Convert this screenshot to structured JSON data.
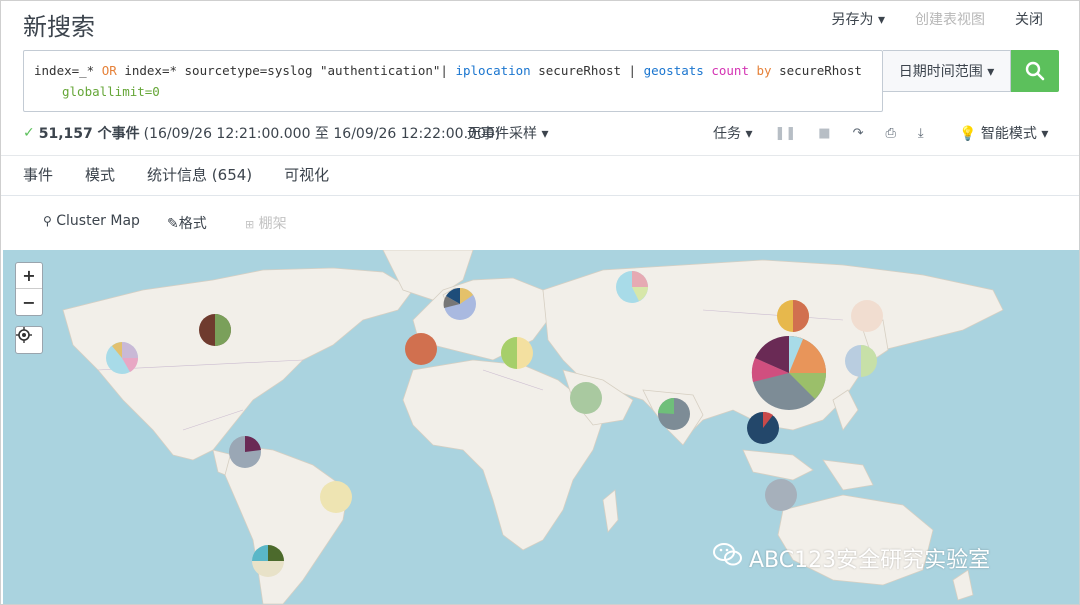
{
  "header": {
    "title": "新搜索",
    "save_as": "另存为 ▾",
    "create_table_view": "创建表视图",
    "close": "关闭"
  },
  "search": {
    "seg1": "index=_* ",
    "seg2": "OR",
    "seg3": " index=* sourcetype=syslog  \"authentication\"| ",
    "seg4": "iplocation",
    "seg5": " secureRhost | ",
    "seg6": "geostats",
    "seg7": " ",
    "seg8": "count",
    "seg9": " ",
    "seg10": "by",
    "seg11": " secureRhost",
    "seg12": "globallimit=0",
    "time_range": "日期时间范围 ▾"
  },
  "status": {
    "event_count": "51,157 个事件",
    "range": "(16/09/26 12:21:00.000 至 16/09/26 12:22:00.000)",
    "sampling": "无事件采样 ▾",
    "job": "任务 ▾",
    "mode": "智能模式 ▾"
  },
  "tabs": [
    "事件",
    "模式",
    "统计信息 (654)",
    "可视化"
  ],
  "viz_toolbar": {
    "cluster_map": "Cluster Map",
    "format": "格式",
    "trellis": "棚架"
  },
  "watermark": "ABC123安全研究实验室",
  "colors": {
    "accent": "#1e93c6",
    "search_button": "#5cc05c",
    "water": "#aad3df",
    "land": "#f2efe9"
  }
}
